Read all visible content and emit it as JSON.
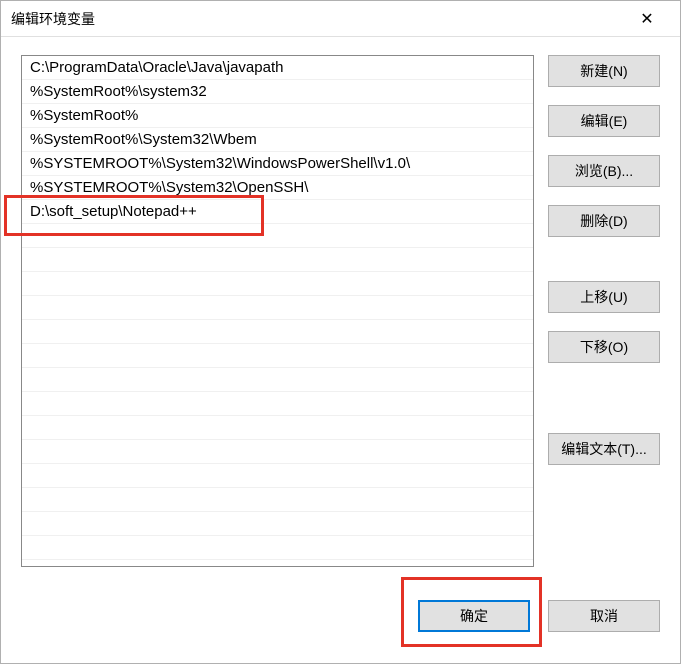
{
  "dialog": {
    "title": "编辑环境变量"
  },
  "list": {
    "items": [
      "C:\\ProgramData\\Oracle\\Java\\javapath",
      "%SystemRoot%\\system32",
      "%SystemRoot%",
      "%SystemRoot%\\System32\\Wbem",
      "%SYSTEMROOT%\\System32\\WindowsPowerShell\\v1.0\\",
      "%SYSTEMROOT%\\System32\\OpenSSH\\",
      "D:\\soft_setup\\Notepad++"
    ]
  },
  "buttons": {
    "new": "新建(N)",
    "edit": "编辑(E)",
    "browse": "浏览(B)...",
    "delete": "删除(D)",
    "moveUp": "上移(U)",
    "moveDown": "下移(O)",
    "editText": "编辑文本(T)...",
    "ok": "确定",
    "cancel": "取消"
  }
}
